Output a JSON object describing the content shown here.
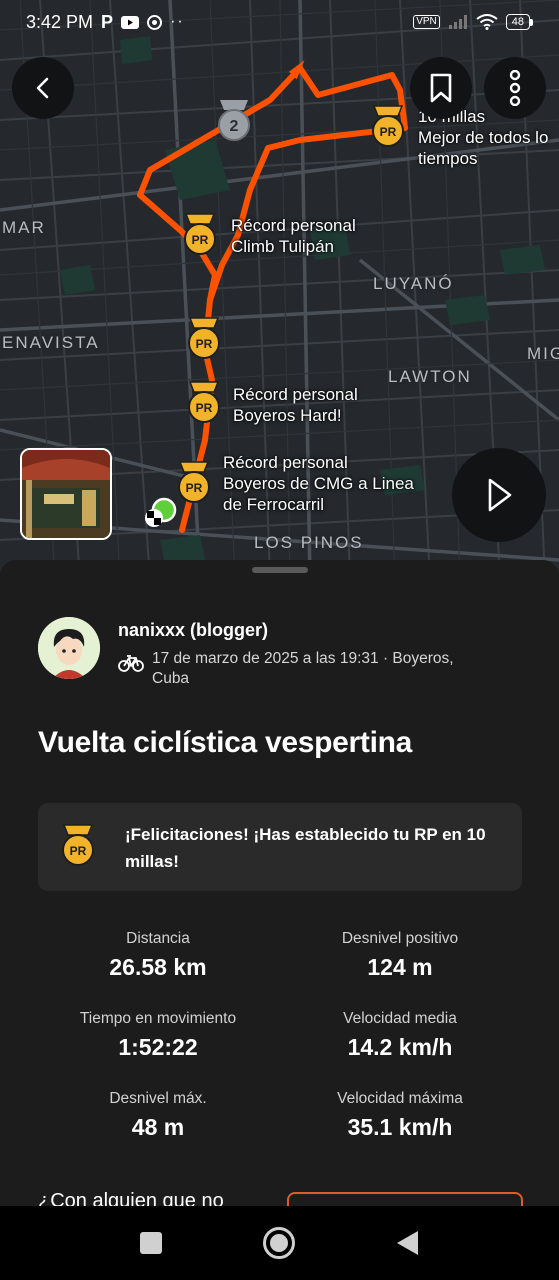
{
  "status_bar": {
    "time": "3:42 PM",
    "left_icons": [
      "parking-icon",
      "youtube-icon",
      "chrome-icon",
      "more-dots-icon"
    ],
    "vpn": "VPN",
    "battery": "48"
  },
  "map": {
    "labels": {
      "mar": "MAR",
      "luyano": "LUYANÓ",
      "enavista": "ENAVISTA",
      "mig": "MIG",
      "lawton": "LAWTON",
      "los_pinos": "LOS PINOS"
    },
    "pr_labels": {
      "tulipan_1": "Récord personal",
      "tulipan_2": "Climb Tulipán",
      "boyeros_hard_1": "Récord personal",
      "boyeros_hard_2": "Boyeros Hard!",
      "cmg_1": "Récord personal",
      "cmg_2": "Boyeros de CMG a Linea",
      "cmg_3": "de Ferrocarril",
      "best_1": "10 millas",
      "best_2": "Mejor de todos lo",
      "best_3": "tiempos"
    },
    "medal_text": {
      "pr": "PR",
      "second": "2"
    },
    "colors": {
      "route": "#fc5200",
      "medal_gold": "#f2b32a",
      "medal_silver": "#9aa0a6",
      "start_dot": "#5fd03a"
    }
  },
  "header_buttons": {
    "back": "chevron-left-icon",
    "bookmark": "bookmark-icon",
    "more": "more-vertical-icon"
  },
  "activity": {
    "athlete": "nanixxx (blogger)",
    "meta": "17 de marzo de 2025 a las 19:31 · Boyeros, Cuba",
    "title": "Vuelta ciclística vespertina",
    "pr_banner": "¡Felicitaciones! ¡Has establecido tu RP en 10 millas!",
    "stats": [
      {
        "label": "Distancia",
        "value": "26.58 km"
      },
      {
        "label": "Desnivel positivo",
        "value": "124 m"
      },
      {
        "label": "Tiempo en movimiento",
        "value": "1:52:22"
      },
      {
        "label": "Velocidad media",
        "value": "14.2 km/h"
      },
      {
        "label": "Desnivel máx.",
        "value": "48 m"
      },
      {
        "label": "Velocidad máxima",
        "value": "35.1 km/h"
      }
    ],
    "cta_text": "¿Con alguien que no"
  },
  "nav": {
    "recents": "square-icon",
    "home": "circle-icon",
    "back": "triangle-back-icon"
  }
}
